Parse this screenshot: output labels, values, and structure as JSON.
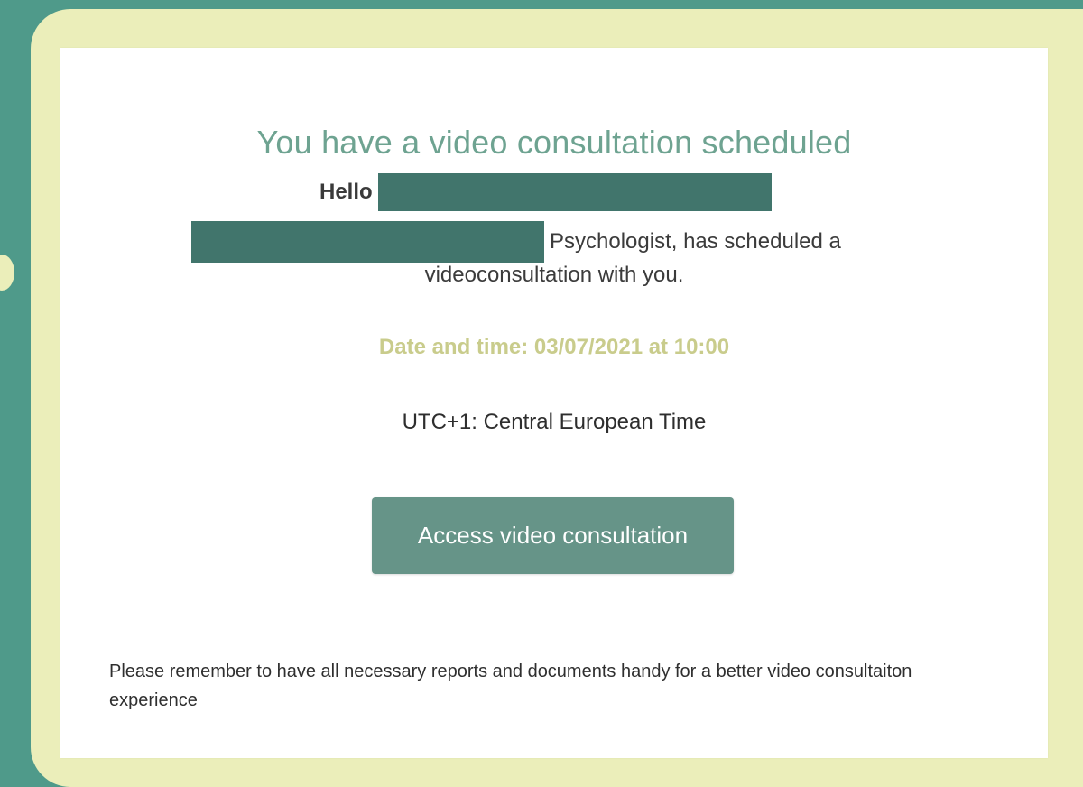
{
  "colors": {
    "page_background": "#4f9a8a",
    "frame": "#ebeeba",
    "card": "#ffffff",
    "heading": "#6ea391",
    "datetime": "#c9cc8c",
    "redaction": "#41756c",
    "button_background": "#669488",
    "button_text": "#ffffff"
  },
  "email": {
    "heading": "You have a video consultation scheduled",
    "greeting": "Hello",
    "sender_line_1": "Psychologist, has scheduled a",
    "sender_line_2": "videoconsultation with you.",
    "datetime": "Date and time: 03/07/2021 at 10:00",
    "timezone": "UTC+1: Central European Time",
    "button_label": "Access video consultation",
    "footer_note": "Please remember to have all necessary reports and documents handy for a better video consultaiton experience"
  }
}
